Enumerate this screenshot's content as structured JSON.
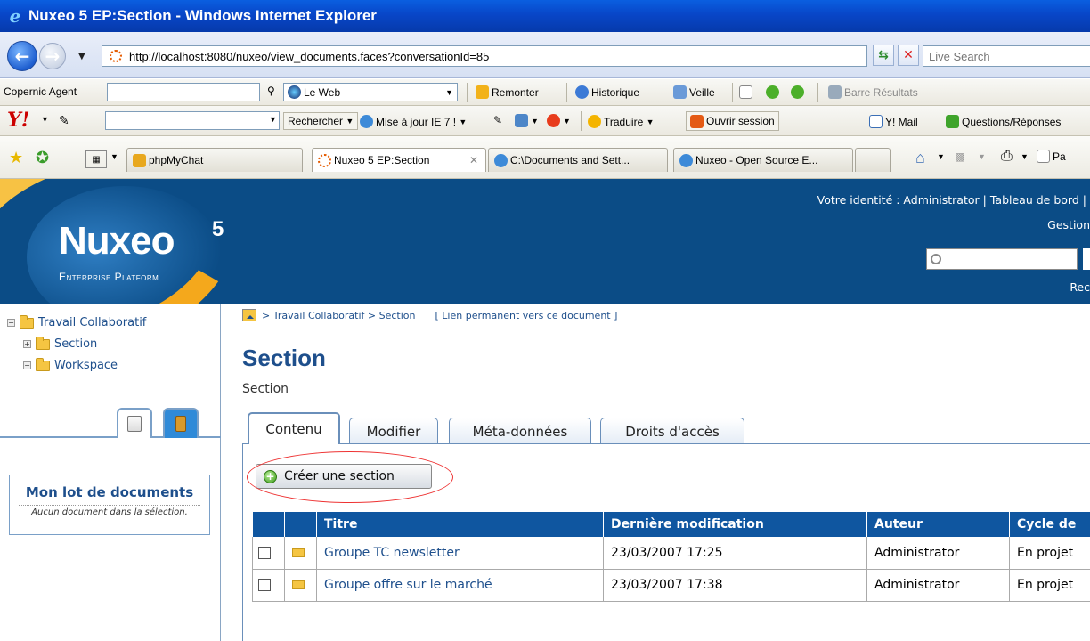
{
  "window": {
    "title": "Nuxeo 5 EP:Section - Windows Internet Explorer"
  },
  "addressbar": {
    "url": "http://localhost:8080/nuxeo/view_documents.faces?conversationId=85",
    "search_placeholder": "Live Search"
  },
  "toolbar1": {
    "copernic_label": "Copernic Agent",
    "le_web": "Le Web",
    "remonter": "Remonter",
    "historique": "Historique",
    "veille": "Veille",
    "barre_resultats": "Barre Résultats"
  },
  "toolbar2": {
    "rechercher": "Rechercher",
    "mise_a_jour": "Mise à jour IE 7 !",
    "traduire": "Traduire",
    "ouvrir_session": "Ouvrir session",
    "ymail": "Y! Mail",
    "questions": "Questions/Réponses"
  },
  "browser_tabs": [
    {
      "label": "phpMyChat"
    },
    {
      "label": "Nuxeo 5 EP:Section",
      "active": true
    },
    {
      "label": "C:\\Documents and Sett..."
    },
    {
      "label": "Nuxeo - Open Source E..."
    }
  ],
  "toolbar3": {
    "page_label": "Pa"
  },
  "header": {
    "logo": "Nuxeo",
    "logo_sup": "5",
    "logo_sub": "Enterprise Platform",
    "identity_label": "Votre identité : Administrator",
    "dashboard_link": "Tableau de bord",
    "gestion_link": "Gestion",
    "rec_link": "Rec"
  },
  "sidebar": {
    "tree": [
      {
        "label": "Travail Collaboratif",
        "level": 0
      },
      {
        "label": "Section",
        "level": 1
      },
      {
        "label": "Workspace",
        "level": 1
      }
    ],
    "lot_title": "Mon lot de documents",
    "lot_empty": "Aucun document dans la sélection."
  },
  "main": {
    "breadcrumb_path": "> Travail Collaboratif > Section",
    "permalink": "[ Lien permanent vers ce document ]",
    "title": "Section",
    "subtitle": "Section",
    "tabs": [
      {
        "label": "Contenu",
        "active": true
      },
      {
        "label": "Modifier"
      },
      {
        "label": "Méta-données"
      },
      {
        "label": "Droits d'accès"
      }
    ],
    "create_button": "Créer une section",
    "table": {
      "headers": [
        "",
        "",
        "Titre",
        "Dernière modification",
        "Auteur",
        "Cycle de"
      ],
      "rows": [
        {
          "title": "Groupe TC newsletter",
          "modified": "23/03/2007 17:25",
          "author": "Administrator",
          "lifecycle": "En projet"
        },
        {
          "title": "Groupe offre sur le marché",
          "modified": "23/03/2007 17:38",
          "author": "Administrator",
          "lifecycle": "En projet"
        }
      ]
    }
  },
  "colors": {
    "brand_blue": "#0b4c86",
    "link_blue": "#1e4f8c",
    "table_header": "#0f56a0",
    "highlight_red": "#e33333"
  }
}
